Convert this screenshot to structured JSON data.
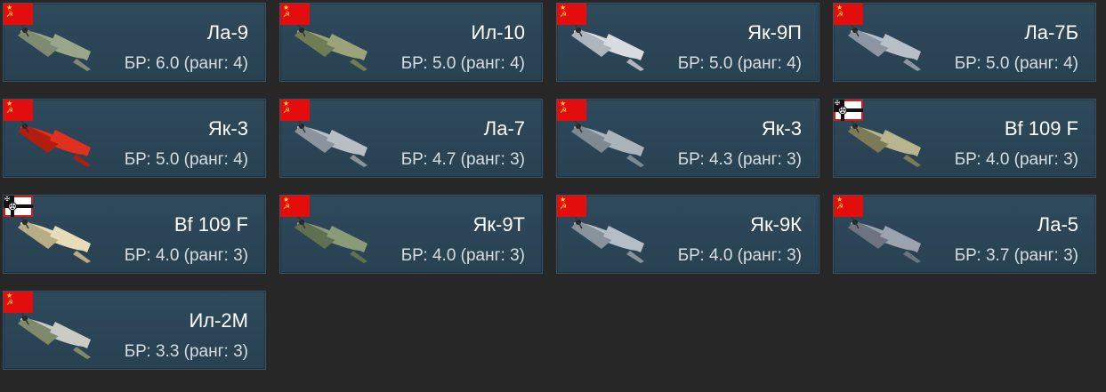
{
  "vehicles": [
    {
      "name": "Ла-9",
      "br": "БР: 6.0 (ранг: 4)",
      "nation": "ussr",
      "icon": "la-9-aircraft-icon",
      "body": "#9aa68a",
      "accent": "#7e8b70"
    },
    {
      "name": "Ил-10",
      "br": "БР: 5.0 (ранг: 4)",
      "nation": "ussr",
      "icon": "il-10-aircraft-icon",
      "body": "#9aa37a",
      "accent": "#6f7d55"
    },
    {
      "name": "Як-9П",
      "br": "БР: 5.0 (ранг: 4)",
      "nation": "ussr",
      "icon": "yak-9p-aircraft-icon",
      "body": "#d8dcdf",
      "accent": "#aeb6bd"
    },
    {
      "name": "Ла-7Б",
      "br": "БР: 5.0 (ранг: 4)",
      "nation": "ussr",
      "icon": "la-7b-aircraft-icon",
      "body": "#b7bfc8",
      "accent": "#8c96a2"
    },
    {
      "name": "Як-3",
      "br": "БР: 5.0 (ранг: 4)",
      "nation": "ussr",
      "icon": "yak-3-red-aircraft-icon",
      "body": "#e0301e",
      "accent": "#b21d10"
    },
    {
      "name": "Ла-7",
      "br": "БР: 4.7 (ранг: 3)",
      "nation": "ussr",
      "icon": "la-7-aircraft-icon",
      "body": "#b9bec5",
      "accent": "#8b939c"
    },
    {
      "name": "Як-3",
      "br": "БР: 4.3 (ранг: 3)",
      "nation": "ussr",
      "icon": "yak-3-aircraft-icon",
      "body": "#a9b4ba",
      "accent": "#7d8a92"
    },
    {
      "name": "Bf 109 F",
      "br": "БР: 4.0 (ранг: 3)",
      "nation": "germany",
      "icon": "bf-109-f-aircraft-icon",
      "body": "#b8b48e",
      "accent": "#7d7a58"
    },
    {
      "name": "Bf 109 F",
      "br": "БР: 4.0 (ранг: 3)",
      "nation": "germany",
      "icon": "bf-109-f-desert-aircraft-icon",
      "body": "#e6dcb8",
      "accent": "#b9ad85"
    },
    {
      "name": "Як-9Т",
      "br": "БР: 4.0 (ранг: 3)",
      "nation": "ussr",
      "icon": "yak-9t-aircraft-icon",
      "body": "#8a9b78",
      "accent": "#5f6f52"
    },
    {
      "name": "Як-9К",
      "br": "БР: 4.0 (ранг: 3)",
      "nation": "ussr",
      "icon": "yak-9k-aircraft-icon",
      "body": "#b5bec7",
      "accent": "#87929c"
    },
    {
      "name": "Ла-5",
      "br": "БР: 3.7 (ранг: 3)",
      "nation": "ussr",
      "icon": "la-5-aircraft-icon",
      "body": "#9aa3ae",
      "accent": "#6b7480"
    },
    {
      "name": "Ил-2М",
      "br": "БР: 3.3 (ранг: 3)",
      "nation": "ussr",
      "icon": "il-2m-aircraft-icon",
      "body": "#c9ccc4",
      "accent": "#7f8a6c"
    }
  ]
}
